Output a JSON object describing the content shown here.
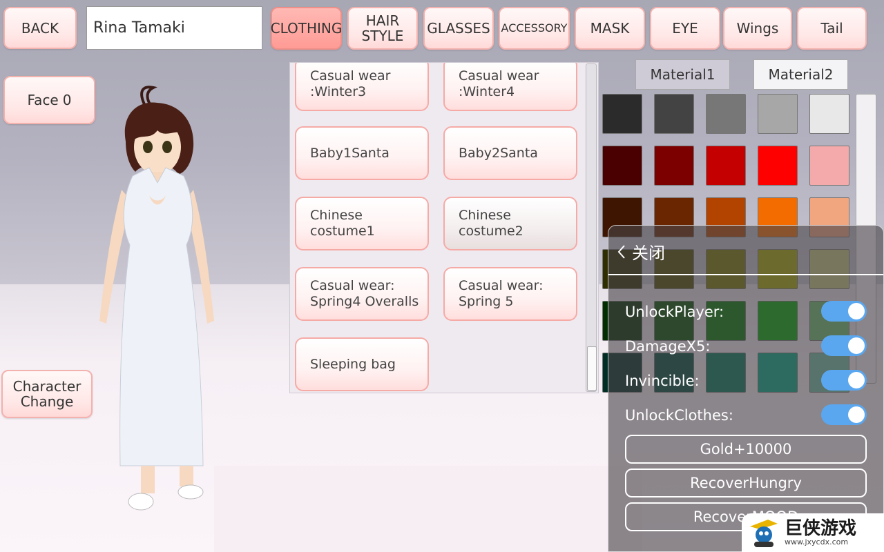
{
  "top_bar": {
    "back_label": "BACK",
    "character_name": "Rina Tamaki",
    "tabs": [
      {
        "label": "CLOTHING",
        "active": true
      },
      {
        "label": "HAIR\nSTYLE",
        "active": false
      },
      {
        "label": "GLASSES",
        "active": false
      },
      {
        "label": "ACCESSORY",
        "active": false
      },
      {
        "label": "MASK",
        "active": false
      },
      {
        "label": "EYE",
        "active": false
      },
      {
        "label": "Wings",
        "active": false
      },
      {
        "label": "Tail",
        "active": false
      }
    ]
  },
  "left_panel": {
    "face_label": "Face",
    "face_value": "0",
    "character_change_label": "Character\nChange"
  },
  "clothing_list": [
    "Casual wear\n:Winter3",
    "Casual wear\n:Winter4",
    "Baby1Santa",
    "Baby2Santa",
    "Chinese costume1",
    "Chinese costume2",
    "Casual wear:\nSpring4 Overalls",
    "Casual wear:\nSpring 5",
    "Sleeping bag"
  ],
  "material_tabs": [
    "Material1",
    "Material2"
  ],
  "color_palette": [
    [
      "#2b2b2b",
      "#434343",
      "#777777",
      "#a7a7a7",
      "#e8e8e8"
    ],
    [
      "#4a0000",
      "#7d0000",
      "#c40000",
      "#ff0000",
      "#f4aaaa"
    ],
    [
      "#3d1500",
      "#6a2600",
      "#b34400",
      "#f26c00",
      "#f2a680"
    ],
    [
      "#2e2e00",
      "#4d4d00",
      "#7a7a00",
      "#a8a800",
      "#c8c880"
    ],
    [
      "#002e00",
      "#004f00",
      "#007a00",
      "#00a800",
      "#6fbf6f"
    ],
    [
      "#002e24",
      "#004f3e",
      "#007a5e",
      "#00a884",
      "#6fbfa7"
    ]
  ],
  "cheat_menu": {
    "close_label": "关闭",
    "toggles": [
      {
        "label": "UnlockPlayer:",
        "on": true
      },
      {
        "label": "DamageX5:",
        "on": true
      },
      {
        "label": "Invincible:",
        "on": true
      },
      {
        "label": "UnlockClothes:",
        "on": true
      }
    ],
    "buttons": [
      "Gold+10000",
      "RecoverHungry",
      "RecoverMOOD"
    ]
  },
  "watermark": {
    "title": "巨侠游戏",
    "url": "www.jxycdx.com"
  }
}
